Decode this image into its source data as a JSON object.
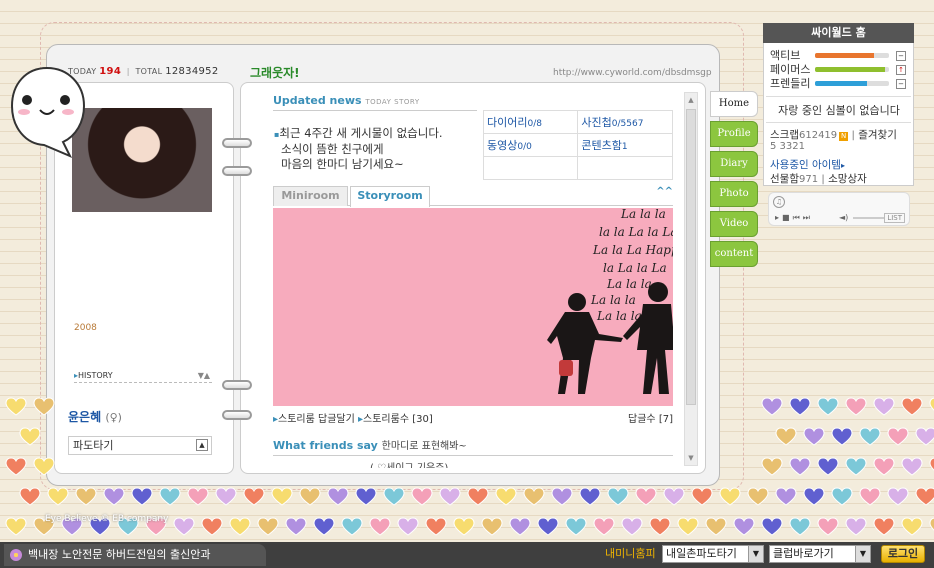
{
  "profile": {
    "today_label": "TODAY",
    "today_count": "194",
    "total_label": "TOTAL",
    "total_count": "12834952",
    "year": "2008",
    "history_label": "HISTORY",
    "owner_name": "윤은혜",
    "owner_gender": "(♀)",
    "mood": "파도타기"
  },
  "header": {
    "site_title": "그래웃자!",
    "site_url": "http://www.cyworld.com/dbsdmsgp"
  },
  "news": {
    "title": "Updated news",
    "subtitle": "TODAY STORY",
    "lines": [
      "최근 4주간 새 게시물이 없습니다.",
      "소식이 뜸한 친구에게",
      "마음의 한마디 남기세요~"
    ]
  },
  "stats": [
    {
      "label": "다이어리",
      "count": "0/8"
    },
    {
      "label": "사진첩",
      "count": "0/5567"
    },
    {
      "label": "동영상",
      "count": "0/0"
    },
    {
      "label": "콘텐츠함",
      "count": "1"
    }
  ],
  "tabs": {
    "miniroom": "Miniroom",
    "storyroom": "Storyroom",
    "caret": "^^"
  },
  "story": {
    "reply_link": "스토리룸 답글달기",
    "count_label": "스토리룸수",
    "count_value": "[30]",
    "reply_count_label": "답글수",
    "reply_count_value": "[7]",
    "art_text": [
      "La la la",
      "la la La la La",
      "La la La Happy",
      "la La la La",
      "La la la",
      "La la la",
      "La la la"
    ]
  },
  "friends": {
    "title": "What friends say",
    "hand": "한마디로 표현해봐~",
    "line": "( ♡세이그 기은주)"
  },
  "side_tabs": [
    "Home",
    "Profile",
    "Diary",
    "Photo",
    "Video",
    "content"
  ],
  "cyworld": {
    "title": "싸이월드 홈",
    "meters": [
      {
        "label": "액티브",
        "value": 0.8,
        "color": "#e8752e",
        "btn": "−"
      },
      {
        "label": "페이머스",
        "value": 0.95,
        "color": "#8fbf2e",
        "btn": "↑"
      },
      {
        "label": "프렌들리",
        "value": 0.7,
        "color": "#2e9fd8",
        "btn": "−"
      }
    ],
    "mood_msg": "자랑 중인 심볼이 없습니다",
    "scrap_label": "스크랩",
    "scrap_count": "612419",
    "fav_label": "즐겨찾기",
    "fav_count": "5 3321",
    "items_label": "사용중인 아이템",
    "gift_label": "선물함",
    "gift_count": "971",
    "shop_label": "소망상자",
    "bgm_list": "LIST"
  },
  "footer": {
    "copyright": "Eye Believe © EB company",
    "banner": "백내장 노안전문 하버드전임의 출신안과",
    "my_mini": "내미니홈피",
    "select1": "내일촌파도타기",
    "select2": "클럽바로가기",
    "login": "로그인"
  },
  "colors": {
    "accent_blue": "#3a8fb8",
    "tab_green": "#8cc63f",
    "story_pink": "#f7abbd",
    "count_red": "#d01010"
  }
}
